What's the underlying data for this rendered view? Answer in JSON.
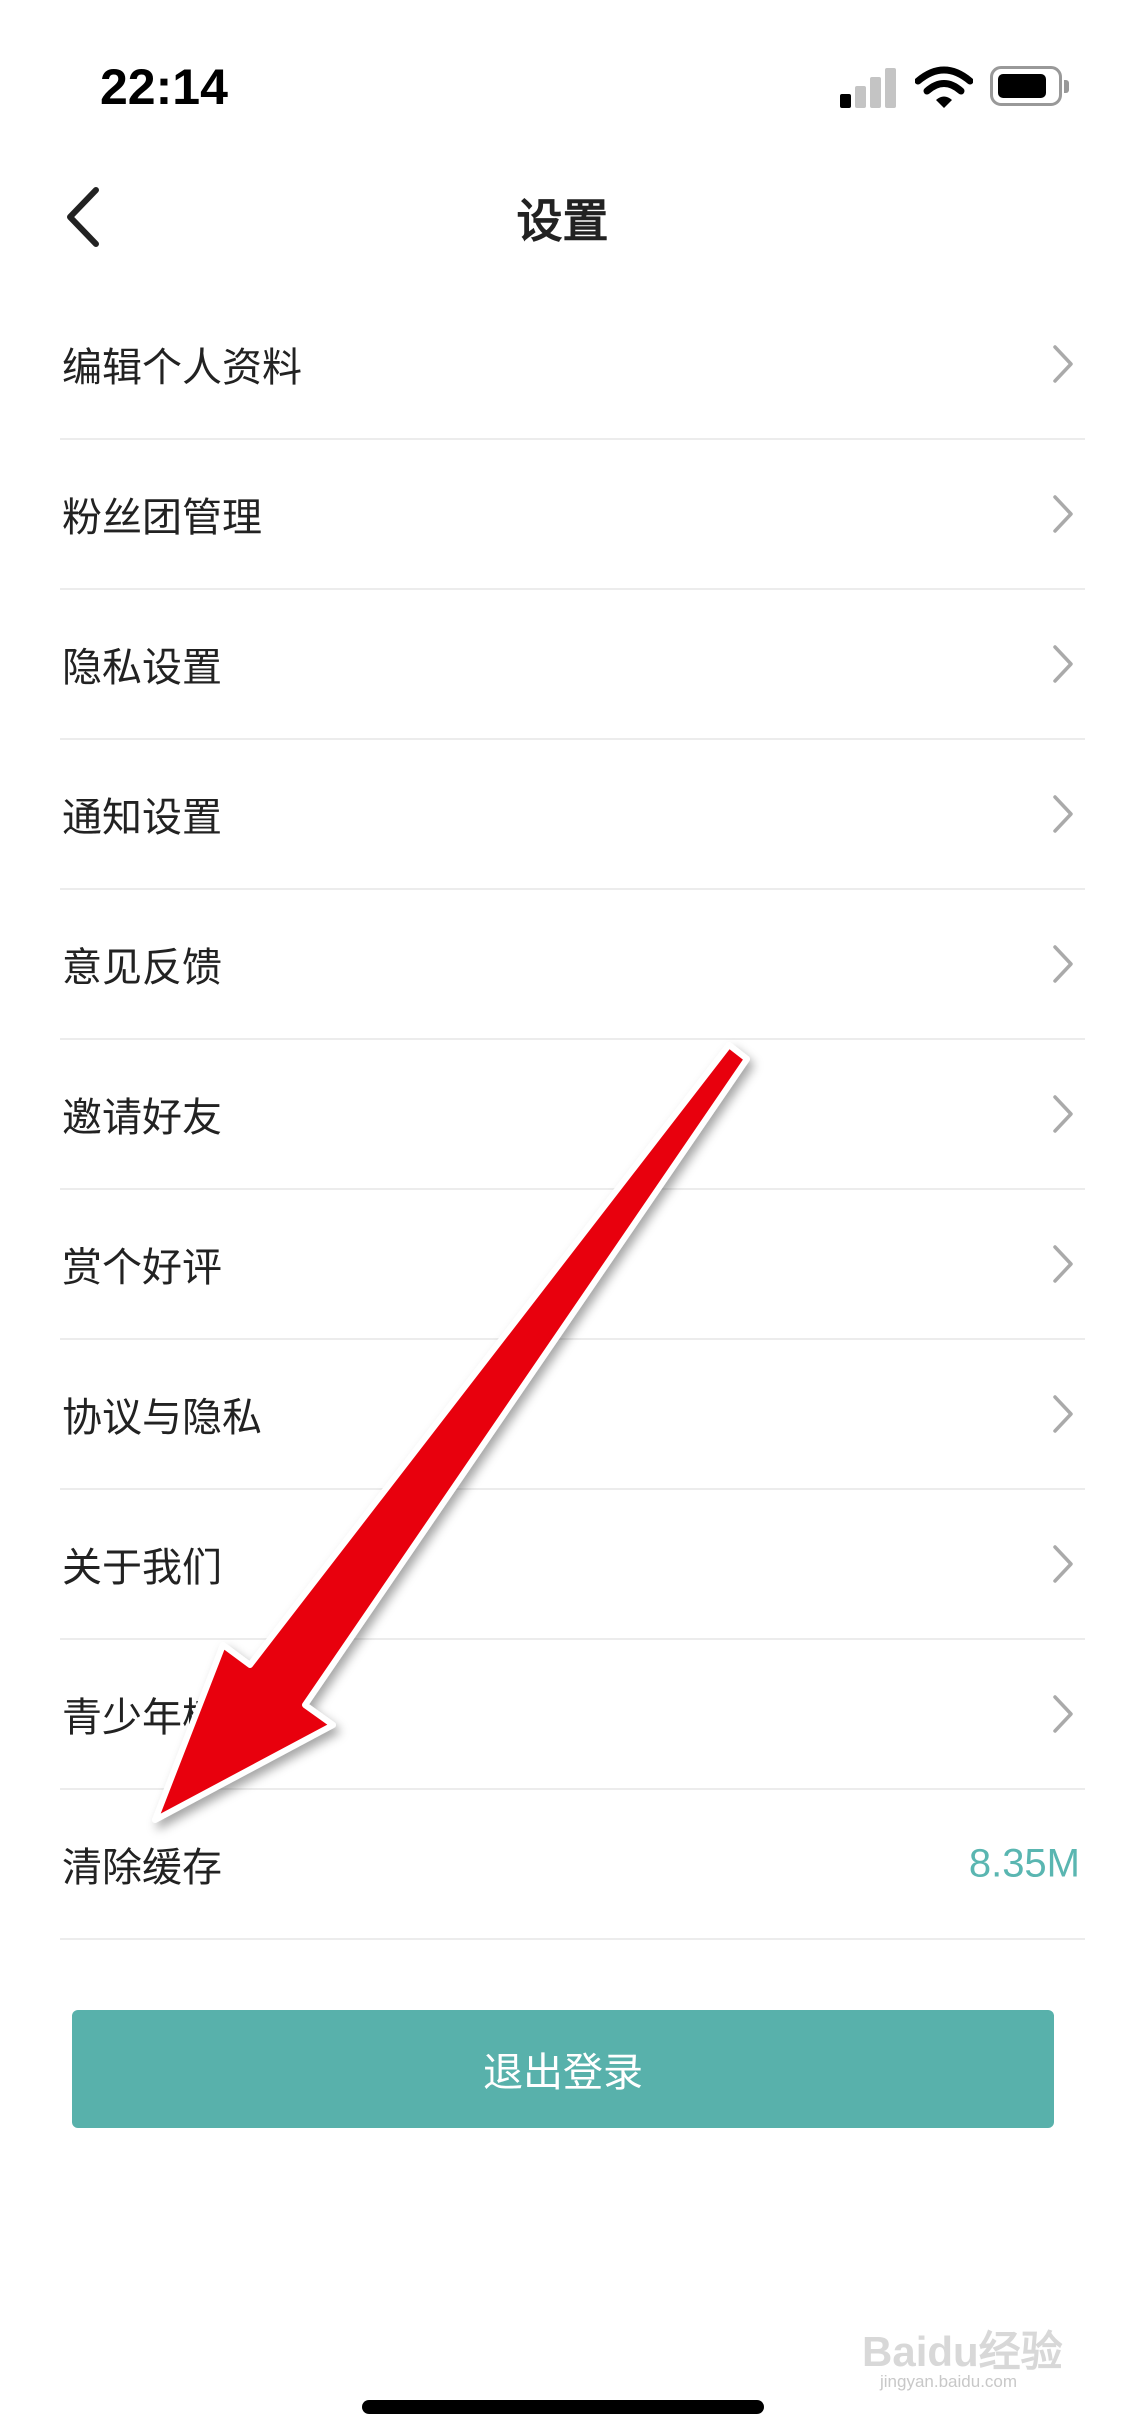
{
  "status_bar": {
    "time": "22:14",
    "signal_bars_active": 1,
    "signal_bars_total": 4
  },
  "nav": {
    "title": "设置",
    "back_icon": "chevron-left-icon"
  },
  "menu": {
    "items": [
      {
        "label": "编辑个人资料",
        "chevron": true
      },
      {
        "label": "粉丝团管理",
        "chevron": true
      },
      {
        "label": "隐私设置",
        "chevron": true
      },
      {
        "label": "通知设置",
        "chevron": true
      },
      {
        "label": "意见反馈",
        "chevron": true
      },
      {
        "label": "邀请好友",
        "chevron": true
      },
      {
        "label": "赏个好评",
        "chevron": true
      },
      {
        "label": "协议与隐私",
        "chevron": true
      },
      {
        "label": "关于我们",
        "chevron": true
      },
      {
        "label": "青少年模式",
        "chevron": true
      },
      {
        "label": "清除缓存",
        "value": "8.35M"
      }
    ]
  },
  "logout": {
    "label": "退出登录"
  },
  "watermark": {
    "text": "Baidu经验",
    "sub": "jingyan.baidu.com"
  },
  "colors": {
    "accent": "#58b1ab",
    "value_text": "#5ab6b1",
    "annotation_arrow": "#e8000b"
  }
}
